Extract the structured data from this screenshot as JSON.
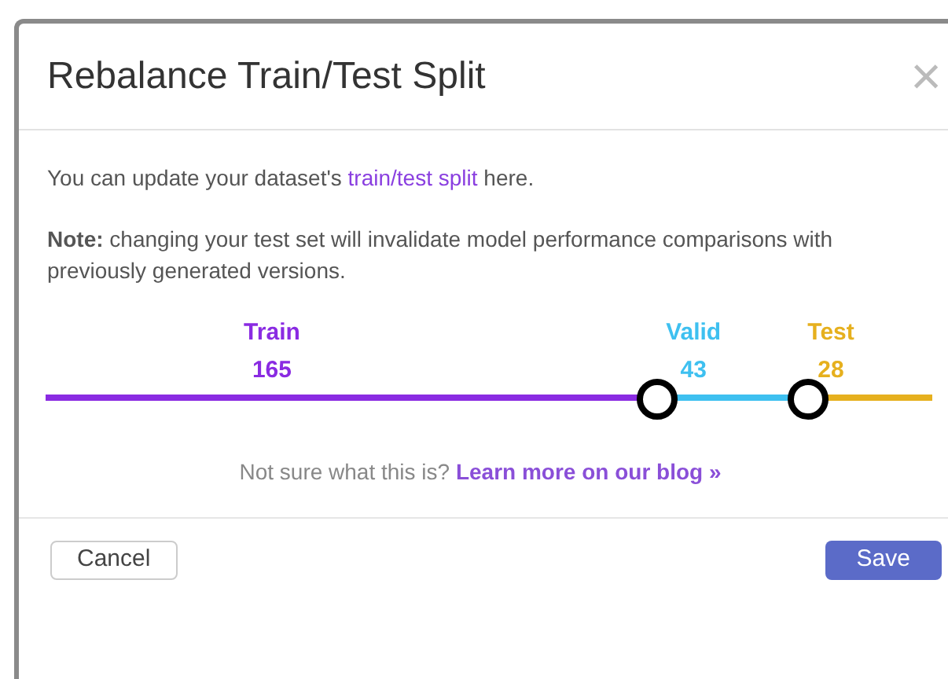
{
  "dialog": {
    "title": "Rebalance Train/Test Split",
    "close": "×",
    "intro": "You can update your dataset's ",
    "intro_link": "train/test split",
    "intro_end": " here.",
    "note": "**Note:** changing your test set will invalidate model performance comparisons with previously generated versions.",
    "split": {
      "segments": [
        {
          "label": "Train",
          "count": "165",
          "color": "#8a2be2"
        },
        {
          "label": "Valid",
          "count": "43",
          "color": "#3ec0f0"
        },
        {
          "label": "Test",
          "count": "28",
          "color": "#e6b01e"
        }
      ],
      "handles": [
        {
          "level": 0.69
        },
        {
          "level": 0.86
        }
      ]
    },
    "hint": "Not sure what this is? ",
    "hint_link": "Learn more on our blog »",
    "buttons": [
      {
        "kind": "secondary",
        "label": "Cancel"
      },
      {
        "kind": "primary",
        "label": "Save"
      }
    ]
  }
}
